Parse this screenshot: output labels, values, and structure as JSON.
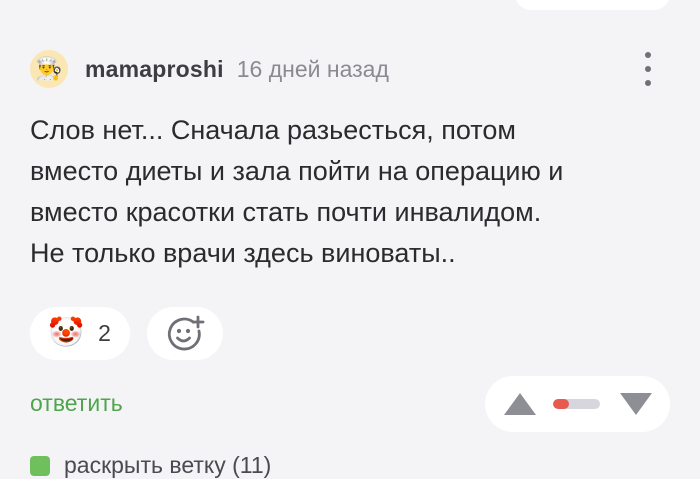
{
  "comment": {
    "author": "mamaproshi",
    "time": "16 дней назад",
    "avatar_icon": "chef-avatar-icon",
    "text": "Слов нет... Сначала разьесться, потом\nвместо диеты и зала пойти на операцию и\nвместо красотки стать почти инвалидом.\nНе только врачи здесь виноваты.."
  },
  "reactions": [
    {
      "icon": "clown-icon",
      "glyph": "🤡",
      "count": "2"
    },
    {
      "icon": "add-reaction-icon"
    }
  ],
  "actions": {
    "reply_label": "ответить"
  },
  "vote": {
    "up_icon": "arrow-up-icon",
    "down_icon": "arrow-down-icon",
    "rating_fraction_positive": 0.35
  },
  "thread": {
    "expand_label": "раскрыть ветку (11)"
  },
  "colors": {
    "background": "#f4f4f7",
    "accent_green": "#4ea54c",
    "rating_red": "#e65a4f"
  }
}
